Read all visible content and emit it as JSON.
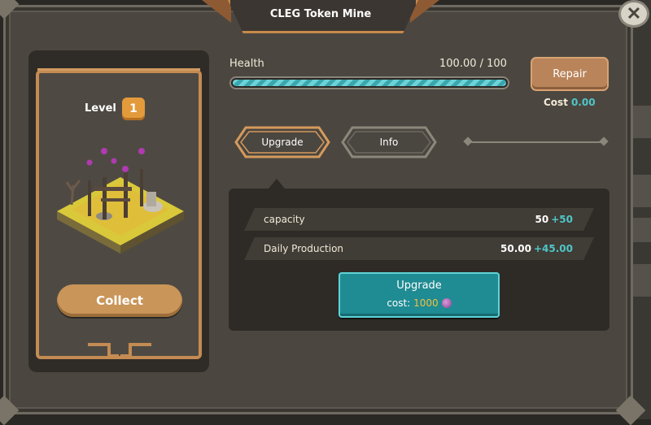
{
  "title": "CLEG Token Mine",
  "close_glyph": "✕",
  "card": {
    "level_label": "Level",
    "level_value": "1",
    "collect_label": "Collect",
    "illustration_icon": "mine-diorama"
  },
  "health": {
    "label": "Health",
    "value_text": "100.00 / 100",
    "fraction": 1.0
  },
  "repair": {
    "button_label": "Repair",
    "cost_label": "Cost",
    "cost_value": "0.00"
  },
  "tabs": [
    {
      "label": "Upgrade",
      "active": true
    },
    {
      "label": "Info",
      "active": false
    }
  ],
  "stats": [
    {
      "name": "capacity",
      "value": "50",
      "plus": "+50"
    },
    {
      "name": "Daily Production",
      "value": "50.00",
      "plus": "+45.00"
    }
  ],
  "upgrade": {
    "button_label": "Upgrade",
    "cost_label": "cost:",
    "cost_value": "1000",
    "currency_icon": "purple-token-icon"
  },
  "colors": {
    "accent_teal": "#4fc6c8",
    "gold_trim": "#c48b52",
    "upgrade_cost": "#f0c040"
  }
}
